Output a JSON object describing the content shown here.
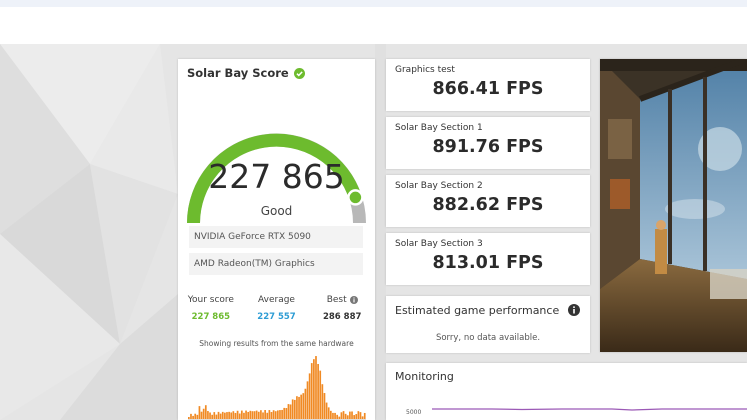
{
  "score": {
    "title": "Solar Bay Score",
    "value": "227 865",
    "rating": "Good",
    "gauge_fraction": 0.9,
    "hardware": [
      "NVIDIA GeForce RTX 5090",
      "AMD Radeon(TM) Graphics"
    ],
    "stats": {
      "your_label": "Your score",
      "your_value": "227 865",
      "average_label": "Average",
      "average_value": "227 557",
      "best_label": "Best",
      "best_value": "286 887"
    },
    "histogram_caption": "Showing results from the same hardware"
  },
  "tests": [
    {
      "label": "Graphics test",
      "value": "866.41 FPS"
    },
    {
      "label": "Solar Bay Section 1",
      "value": "891.76 FPS"
    },
    {
      "label": "Solar Bay Section 2",
      "value": "882.62 FPS"
    },
    {
      "label": "Solar Bay Section 3",
      "value": "813.01 FPS"
    }
  ],
  "estimated": {
    "title": "Estimated game performance",
    "message": "Sorry, no data available."
  },
  "monitoring": {
    "title": "Monitoring",
    "tick": "5000"
  },
  "colors": {
    "gauge_fill": "#6dbb2e",
    "gauge_track": "#b8b8b8",
    "your_score": "#6dbb2e",
    "average": "#2d9cd4",
    "histogram": "#f08a24",
    "monitor_line": "#9b59b6"
  }
}
